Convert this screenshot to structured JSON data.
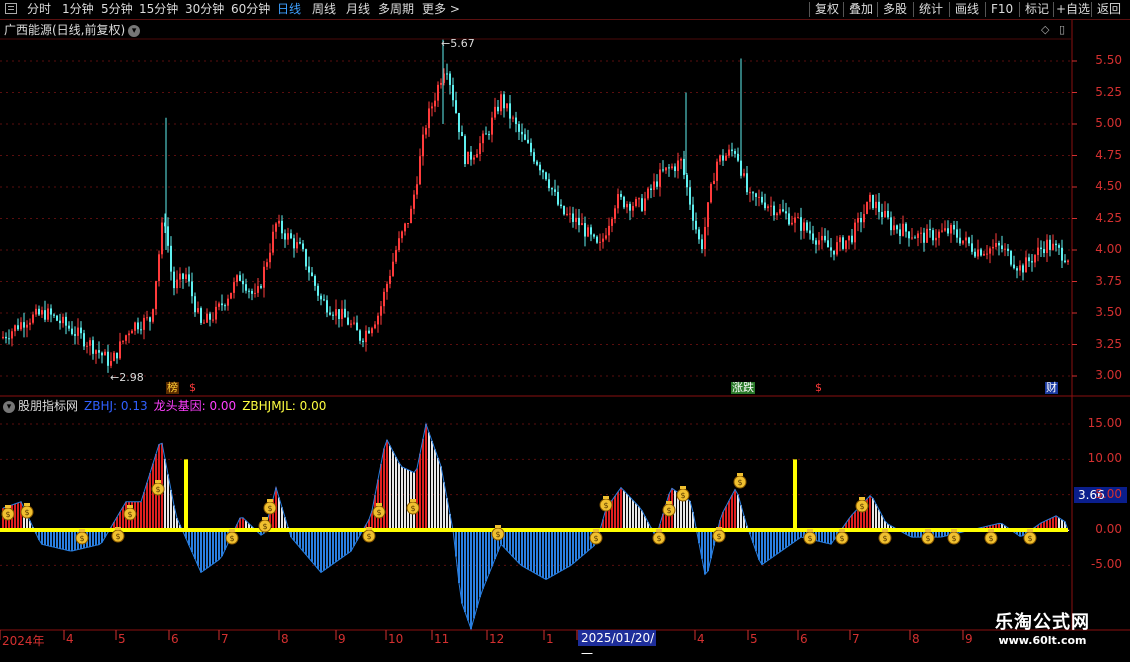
{
  "menu": {
    "left_items": [
      "分时",
      "1分钟",
      "5分钟",
      "15分钟",
      "30分钟",
      "60分钟",
      "日线",
      "周线",
      "月线",
      "多周期",
      "更多 >"
    ],
    "active_index": 6,
    "right_items": [
      "复权",
      "叠加",
      "多股",
      "统计",
      "画线",
      "F10",
      "标记",
      "+自选",
      "返回"
    ]
  },
  "stock": {
    "title": "广西能源(日线,前复权)",
    "high_label": "5.67",
    "low_label": "2.98"
  },
  "price_axis": [
    "5.50",
    "5.25",
    "5.00",
    "4.75",
    "4.50",
    "4.25",
    "4.00",
    "3.75",
    "3.50",
    "3.25",
    "3.00"
  ],
  "indicator": {
    "name": "股朋指标网",
    "line1": "ZBHJ: 0.13",
    "line2": "龙头基因: 0.00",
    "line3": "ZBHJMJL: 0.00",
    "current_value": "3.66",
    "axis": [
      "15.00",
      "10.00",
      "5.00",
      "0.00",
      "-5.00"
    ]
  },
  "markers": {
    "m1": "榜",
    "m2": "$",
    "m3": "涨跌",
    "m4": "$",
    "m5": "财"
  },
  "dates": [
    "2024年",
    "4",
    "5",
    "6",
    "7",
    "8",
    "9",
    "10",
    "11",
    "12",
    "1",
    "2025/01/20/一",
    "4",
    "5",
    "6",
    "7",
    "8",
    "9"
  ],
  "watermark": {
    "line1": "乐淘公式网",
    "line2": "www.60lt.com"
  },
  "colors": {
    "up": "#ff3b3b",
    "down": "#5ff0f0",
    "axis": "#d43030",
    "highlight": "#ffff00",
    "active_menu": "#3ea0ff"
  }
}
